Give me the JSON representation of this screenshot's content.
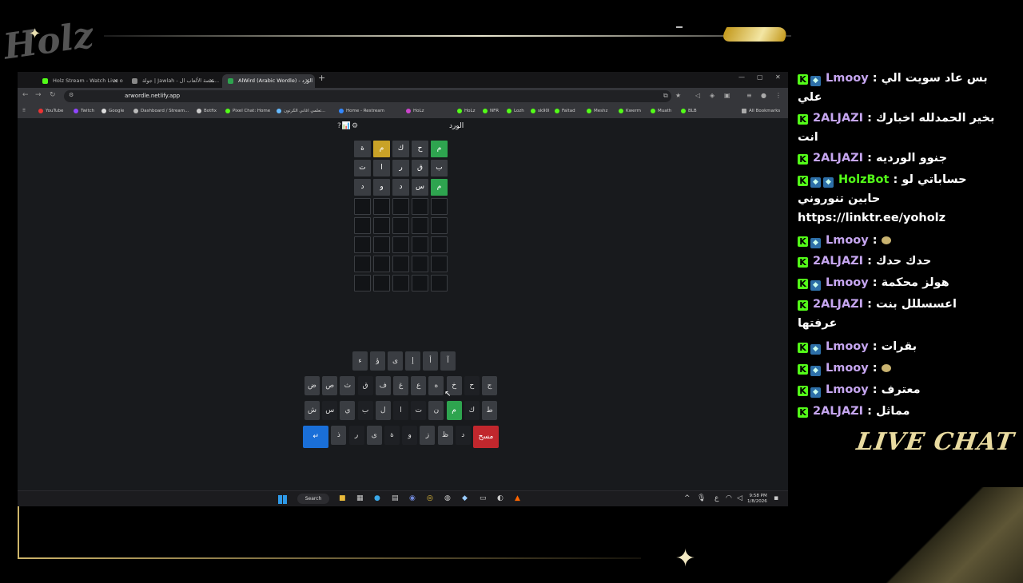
{
  "colors": {
    "kick_green": "#53fc18",
    "correct": "#2ea44f",
    "present": "#c9a227",
    "absent": "#3a3d42",
    "enter_key": "#1a6fd8",
    "delete_key": "#c1272d",
    "accent_gold": "#e9dba0"
  },
  "tabs": [
    {
      "title": "Holz Stream - Watch Live on Ki"
    },
    {
      "title": "جولة | Jawlah - منصة الألعاب ال..."
    },
    {
      "title": "AlWird (Arabic Wordle) - الورد"
    }
  ],
  "address": {
    "url": "arwordle.netlify.app"
  },
  "bookmarks": [
    "YouTube",
    "Twitch",
    "Google",
    "Dashboard / Stream...",
    "Botfix",
    "Pixel Chat: Home",
    "تعلمي اغاني الكرتون...",
    "Home - Restream",
    "HoLz",
    "HoLz",
    "NFR",
    "Lozh",
    "sk90l",
    "Faltad",
    "Meshz",
    "Kwerm",
    "Muath",
    "BLB",
    "All Bookmarks"
  ],
  "game": {
    "title": "الورد",
    "icons": "?📊⚙",
    "rows": [
      [
        {
          "l": "م",
          "s": "correct"
        },
        {
          "l": "ح",
          "s": "absent"
        },
        {
          "l": "ك",
          "s": "absent"
        },
        {
          "l": "م",
          "s": "present"
        },
        {
          "l": "ة",
          "s": "absent"
        }
      ],
      [
        {
          "l": "ب",
          "s": "absent"
        },
        {
          "l": "ق",
          "s": "absent"
        },
        {
          "l": "ر",
          "s": "absent"
        },
        {
          "l": "ا",
          "s": "absent"
        },
        {
          "l": "ت",
          "s": "absent"
        }
      ],
      [
        {
          "l": "م",
          "s": "correct"
        },
        {
          "l": "س",
          "s": "absent"
        },
        {
          "l": "د",
          "s": "absent"
        },
        {
          "l": "و",
          "s": "absent"
        },
        {
          "l": "د",
          "s": "absent"
        }
      ],
      [
        {
          "l": "",
          "s": "empty"
        },
        {
          "l": "",
          "s": "empty"
        },
        {
          "l": "",
          "s": "empty"
        },
        {
          "l": "",
          "s": "empty"
        },
        {
          "l": "",
          "s": "empty"
        }
      ],
      [
        {
          "l": "",
          "s": "empty"
        },
        {
          "l": "",
          "s": "empty"
        },
        {
          "l": "",
          "s": "empty"
        },
        {
          "l": "",
          "s": "empty"
        },
        {
          "l": "",
          "s": "empty"
        }
      ],
      [
        {
          "l": "",
          "s": "empty"
        },
        {
          "l": "",
          "s": "empty"
        },
        {
          "l": "",
          "s": "empty"
        },
        {
          "l": "",
          "s": "empty"
        },
        {
          "l": "",
          "s": "empty"
        }
      ],
      [
        {
          "l": "",
          "s": "empty"
        },
        {
          "l": "",
          "s": "empty"
        },
        {
          "l": "",
          "s": "empty"
        },
        {
          "l": "",
          "s": "empty"
        },
        {
          "l": "",
          "s": "empty"
        }
      ],
      [
        {
          "l": "",
          "s": "empty"
        },
        {
          "l": "",
          "s": "empty"
        },
        {
          "l": "",
          "s": "empty"
        },
        {
          "l": "",
          "s": "empty"
        },
        {
          "l": "",
          "s": "empty"
        }
      ]
    ],
    "keyboard": [
      [
        {
          "k": "آ",
          "s": "gray"
        },
        {
          "k": "أ",
          "s": "gray"
        },
        {
          "k": "إ",
          "s": "gray"
        },
        {
          "k": "ى",
          "s": "gray"
        },
        {
          "k": "ؤ",
          "s": "gray"
        },
        {
          "k": "ء",
          "s": "gray"
        }
      ],
      [
        {
          "k": "ج",
          "s": "gray"
        },
        {
          "k": "ح",
          "s": "dark"
        },
        {
          "k": "خ",
          "s": "gray"
        },
        {
          "k": "ه",
          "s": "gray"
        },
        {
          "k": "ع",
          "s": "gray"
        },
        {
          "k": "غ",
          "s": "gray"
        },
        {
          "k": "ف",
          "s": "gray"
        },
        {
          "k": "ق",
          "s": "dark"
        },
        {
          "k": "ث",
          "s": "gray"
        },
        {
          "k": "ص",
          "s": "gray"
        },
        {
          "k": "ض",
          "s": "gray"
        }
      ],
      [
        {
          "k": "ط",
          "s": "gray"
        },
        {
          "k": "ك",
          "s": "dark"
        },
        {
          "k": "م",
          "s": "green"
        },
        {
          "k": "ن",
          "s": "gray"
        },
        {
          "k": "ت",
          "s": "dark"
        },
        {
          "k": "ا",
          "s": "dark"
        },
        {
          "k": "ل",
          "s": "gray"
        },
        {
          "k": "ب",
          "s": "dark"
        },
        {
          "k": "ي",
          "s": "gray"
        },
        {
          "k": "س",
          "s": "dark"
        },
        {
          "k": "ش",
          "s": "gray"
        }
      ],
      [
        {
          "k": "مسح",
          "s": "red"
        },
        {
          "k": "د",
          "s": "dark"
        },
        {
          "k": "ظ",
          "s": "gray"
        },
        {
          "k": "ز",
          "s": "gray"
        },
        {
          "k": "و",
          "s": "dark"
        },
        {
          "k": "ة",
          "s": "dark"
        },
        {
          "k": "ى",
          "s": "gray"
        },
        {
          "k": "ر",
          "s": "dark"
        },
        {
          "k": "ذ",
          "s": "gray"
        },
        {
          "k": "↵",
          "s": "blue"
        }
      ]
    ]
  },
  "taskbar": {
    "search": "Search",
    "time": "9:58 PM",
    "date": "1/8/2026",
    "lang": "ع"
  },
  "chat": {
    "messages": [
      {
        "user": "Lmooy",
        "color": "#c6a6f0",
        "badges": [
          "b"
        ],
        "text": "بس عاد سويت الي"
      },
      {
        "user": "",
        "color": "#fff",
        "badges": [],
        "text": "علي"
      },
      {
        "user": "2ALJAZI",
        "color": "#c6a6f0",
        "badges": [],
        "text": "بخير الحمدلله اخبارك"
      },
      {
        "user": "",
        "color": "#fff",
        "badges": [],
        "text": "انت"
      },
      {
        "user": "2ALJAZI",
        "color": "#c6a6f0",
        "badges": [],
        "text": "جنوو الورديه"
      },
      {
        "user": "HolzBot",
        "color": "#53fc18",
        "badges": [
          "b",
          "b"
        ],
        "text": "حساباتي لو"
      },
      {
        "user": "",
        "color": "#fff",
        "badges": [],
        "text": "حابين تنوروني"
      },
      {
        "user": "",
        "color": "#fff",
        "badges": [],
        "text": "https://linktr.ee/yoholz"
      },
      {
        "user": "Lmooy",
        "color": "#c6a6f0",
        "badges": [
          "b"
        ],
        "text": ""
      },
      {
        "user": "2ALJAZI",
        "color": "#c6a6f0",
        "badges": [],
        "text": "حدك حدك"
      },
      {
        "user": "Lmooy",
        "color": "#c6a6f0",
        "badges": [
          "b"
        ],
        "text": "هولز محكمة"
      },
      {
        "user": "2ALJAZI",
        "color": "#c6a6f0",
        "badges": [],
        "text": "اعسسللل بنت"
      },
      {
        "user": "",
        "color": "#fff",
        "badges": [],
        "text": "عرفتها"
      },
      {
        "user": "Lmooy",
        "color": "#c6a6f0",
        "badges": [
          "b"
        ],
        "text": "بقرات"
      },
      {
        "user": "Lmooy",
        "color": "#c6a6f0",
        "badges": [
          "b"
        ],
        "text": ""
      },
      {
        "user": "Lmooy",
        "color": "#c6a6f0",
        "badges": [
          "b"
        ],
        "text": "معترف"
      },
      {
        "user": "2ALJAZI",
        "color": "#c6a6f0",
        "badges": [],
        "text": "مماثل"
      }
    ],
    "footer": "LIVE CHAT"
  },
  "overlay": {
    "logo": "Holz"
  }
}
